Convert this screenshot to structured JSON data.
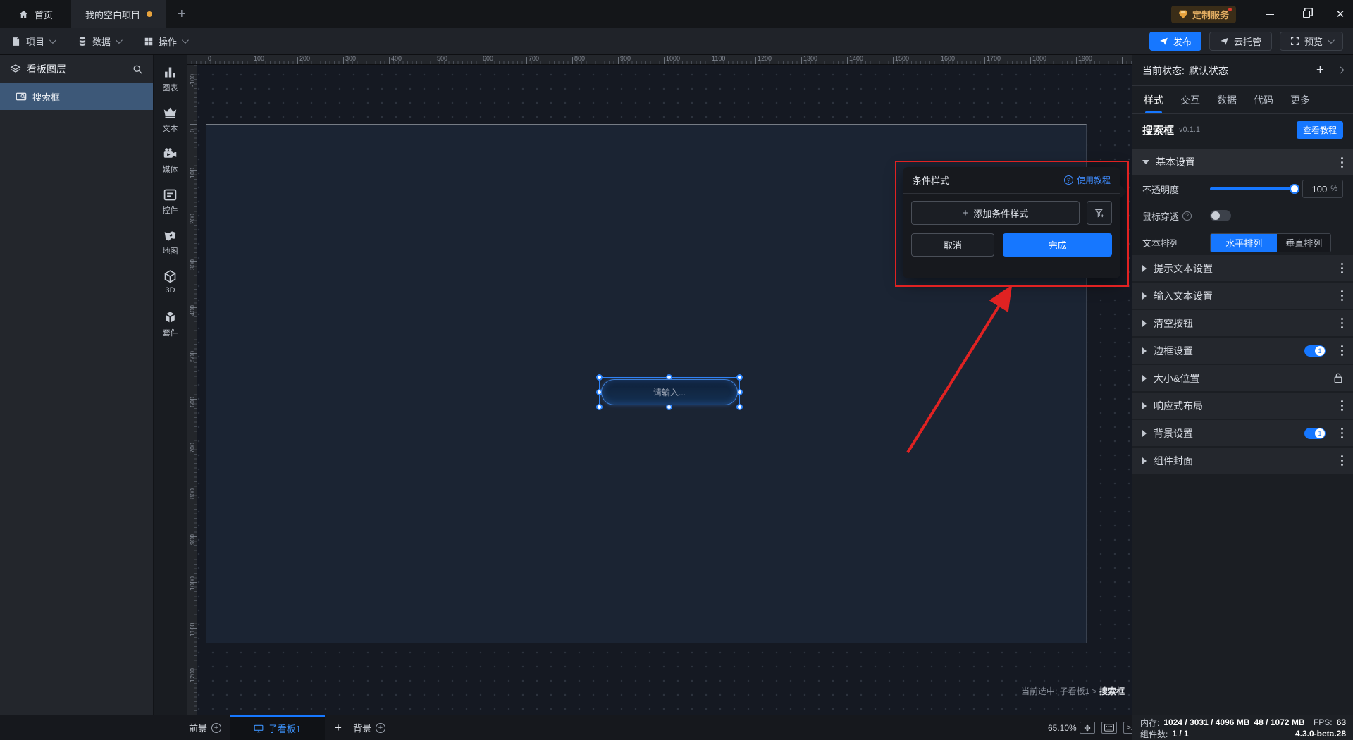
{
  "topbar": {
    "home": "首页",
    "project_tab": "我的空白项目",
    "custom_service": "定制服务"
  },
  "menubar": {
    "items": [
      {
        "label": "项目"
      },
      {
        "label": "数据"
      },
      {
        "label": "操作"
      }
    ],
    "publish": "发布",
    "cloud": "云托管",
    "preview": "预览"
  },
  "layers_panel": {
    "title": "看板图层",
    "items": [
      {
        "label": "搜索框"
      }
    ]
  },
  "component_dock": {
    "items": [
      {
        "icon": "chart-icon",
        "label": "图表"
      },
      {
        "icon": "text-icon",
        "label": "文本"
      },
      {
        "icon": "media-icon",
        "label": "媒体"
      },
      {
        "icon": "widget-icon",
        "label": "控件"
      },
      {
        "icon": "map-icon",
        "label": "地图"
      },
      {
        "icon": "cube-3d-icon",
        "label": "3D"
      },
      {
        "icon": "kit-icon",
        "label": "套件"
      }
    ]
  },
  "canvas": {
    "h_ruler_labels": [
      "0",
      "100",
      "200",
      "300",
      "400",
      "500",
      "600",
      "700",
      "800",
      "900",
      "1000",
      "1100",
      "1200",
      "1300",
      "1400",
      "1500",
      "1600",
      "1700",
      "1800",
      "1900"
    ],
    "v_ruler_labels": [
      "-100",
      "0",
      "100",
      "200",
      "300",
      "400",
      "500",
      "600",
      "700",
      "800",
      "900",
      "1000",
      "1100",
      "1200"
    ],
    "component_placeholder": "请输入...",
    "hint_prefix": "当前选中: ",
    "hint_path": "子看板1 > ",
    "hint_name": "搜索框"
  },
  "popup": {
    "title": "条件样式",
    "help": "使用教程",
    "add_label": "添加条件样式",
    "cancel": "取消",
    "confirm": "完成"
  },
  "inspector": {
    "state_label": "当前状态:",
    "state_value": "默认状态",
    "tabs": [
      "样式",
      "交互",
      "数据",
      "代码",
      "更多"
    ],
    "active_tab": "样式",
    "component_name": "搜索框",
    "component_version": "v0.1.1",
    "tutorial_btn": "查看教程",
    "basic_title": "基本设置",
    "opacity_label": "不透明度",
    "opacity_value": "100",
    "opacity_unit": "%",
    "mouse_through_label": "鼠标穿透",
    "align_label": "文本排列",
    "align_horizontal": "水平排列",
    "align_vertical": "垂直排列",
    "sections": [
      {
        "label": "提示文本设置",
        "toggle": false,
        "lock": false
      },
      {
        "label": "输入文本设置",
        "toggle": false,
        "lock": false
      },
      {
        "label": "清空按钮",
        "toggle": false,
        "lock": false
      },
      {
        "label": "边框设置",
        "toggle": true,
        "lock": false
      },
      {
        "label": "大小&位置",
        "toggle": false,
        "lock": true
      },
      {
        "label": "响应式布局",
        "toggle": false,
        "lock": false
      },
      {
        "label": "背景设置",
        "toggle": true,
        "lock": false
      },
      {
        "label": "组件封面",
        "toggle": false,
        "lock": false
      }
    ]
  },
  "bottombar": {
    "foreground": "前景",
    "board_tab": "子看板1",
    "background": "背景",
    "zoom": "65.10%"
  },
  "statusbar": {
    "mem_label": "内存:",
    "mem_value": "1024 / 3031 / 4096 MB",
    "mem_extra": "48 / 1072 MB",
    "fps_label": "FPS:",
    "fps_value": "63",
    "comp_label": "组件数:",
    "comp_value": "1 / 1",
    "version": "4.3.0-beta.28"
  },
  "colors": {
    "accent": "#1677ff",
    "annotation_red": "#e02222",
    "selection_blue": "#2f83f7",
    "service_gold": "#e2ad62"
  }
}
